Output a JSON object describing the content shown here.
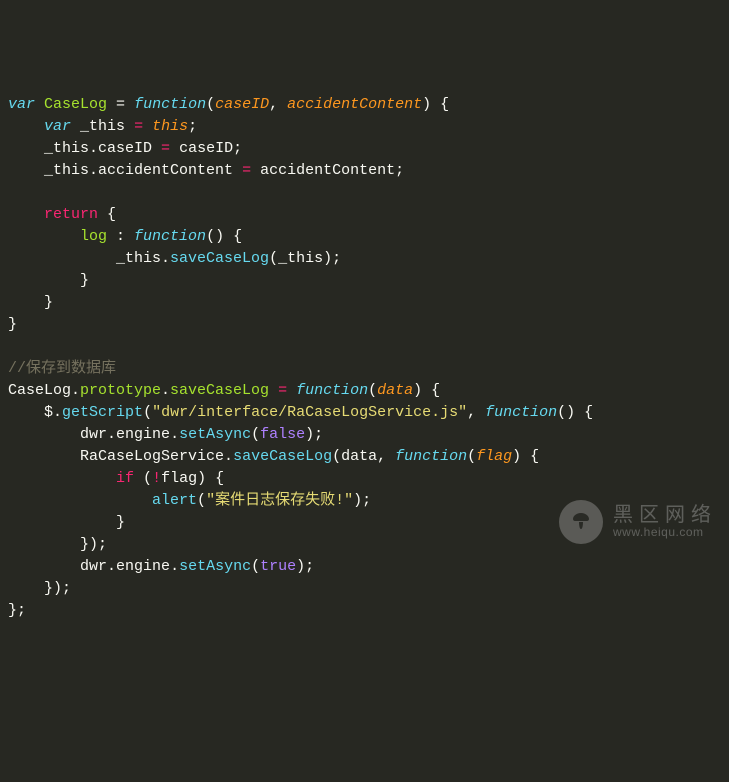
{
  "t": {
    "kw_var": "var",
    "CaseLog": "CaseLog",
    "eq": " = ",
    "fn": "function",
    "p_caseID": "caseID",
    "p_accidentContent": "accidentContent",
    "_this": "_this",
    "this": "this",
    "ret": "return",
    "log": "log",
    "saveCaseLog": "saveCaseLog",
    "comment_db": "//保存到数据库",
    "prototype": "prototype",
    "p_data": "data",
    "jq": "$",
    "getScript": "getScript",
    "str_dwr": "\"dwr/interface/RaCaseLogService.js\"",
    "dwr": "dwr",
    "engine": "engine",
    "setAsync": "setAsync",
    "false": "false",
    "true": "true",
    "RaCaseLogService": "RaCaseLogService",
    "p_flag": "flag",
    "if": "if",
    "bang": "!",
    "alert": "alert",
    "str_fail": "\"案件日志保存失败!\""
  },
  "watermark": {
    "title": "黑区网络",
    "url": "www.heiqu.com"
  }
}
